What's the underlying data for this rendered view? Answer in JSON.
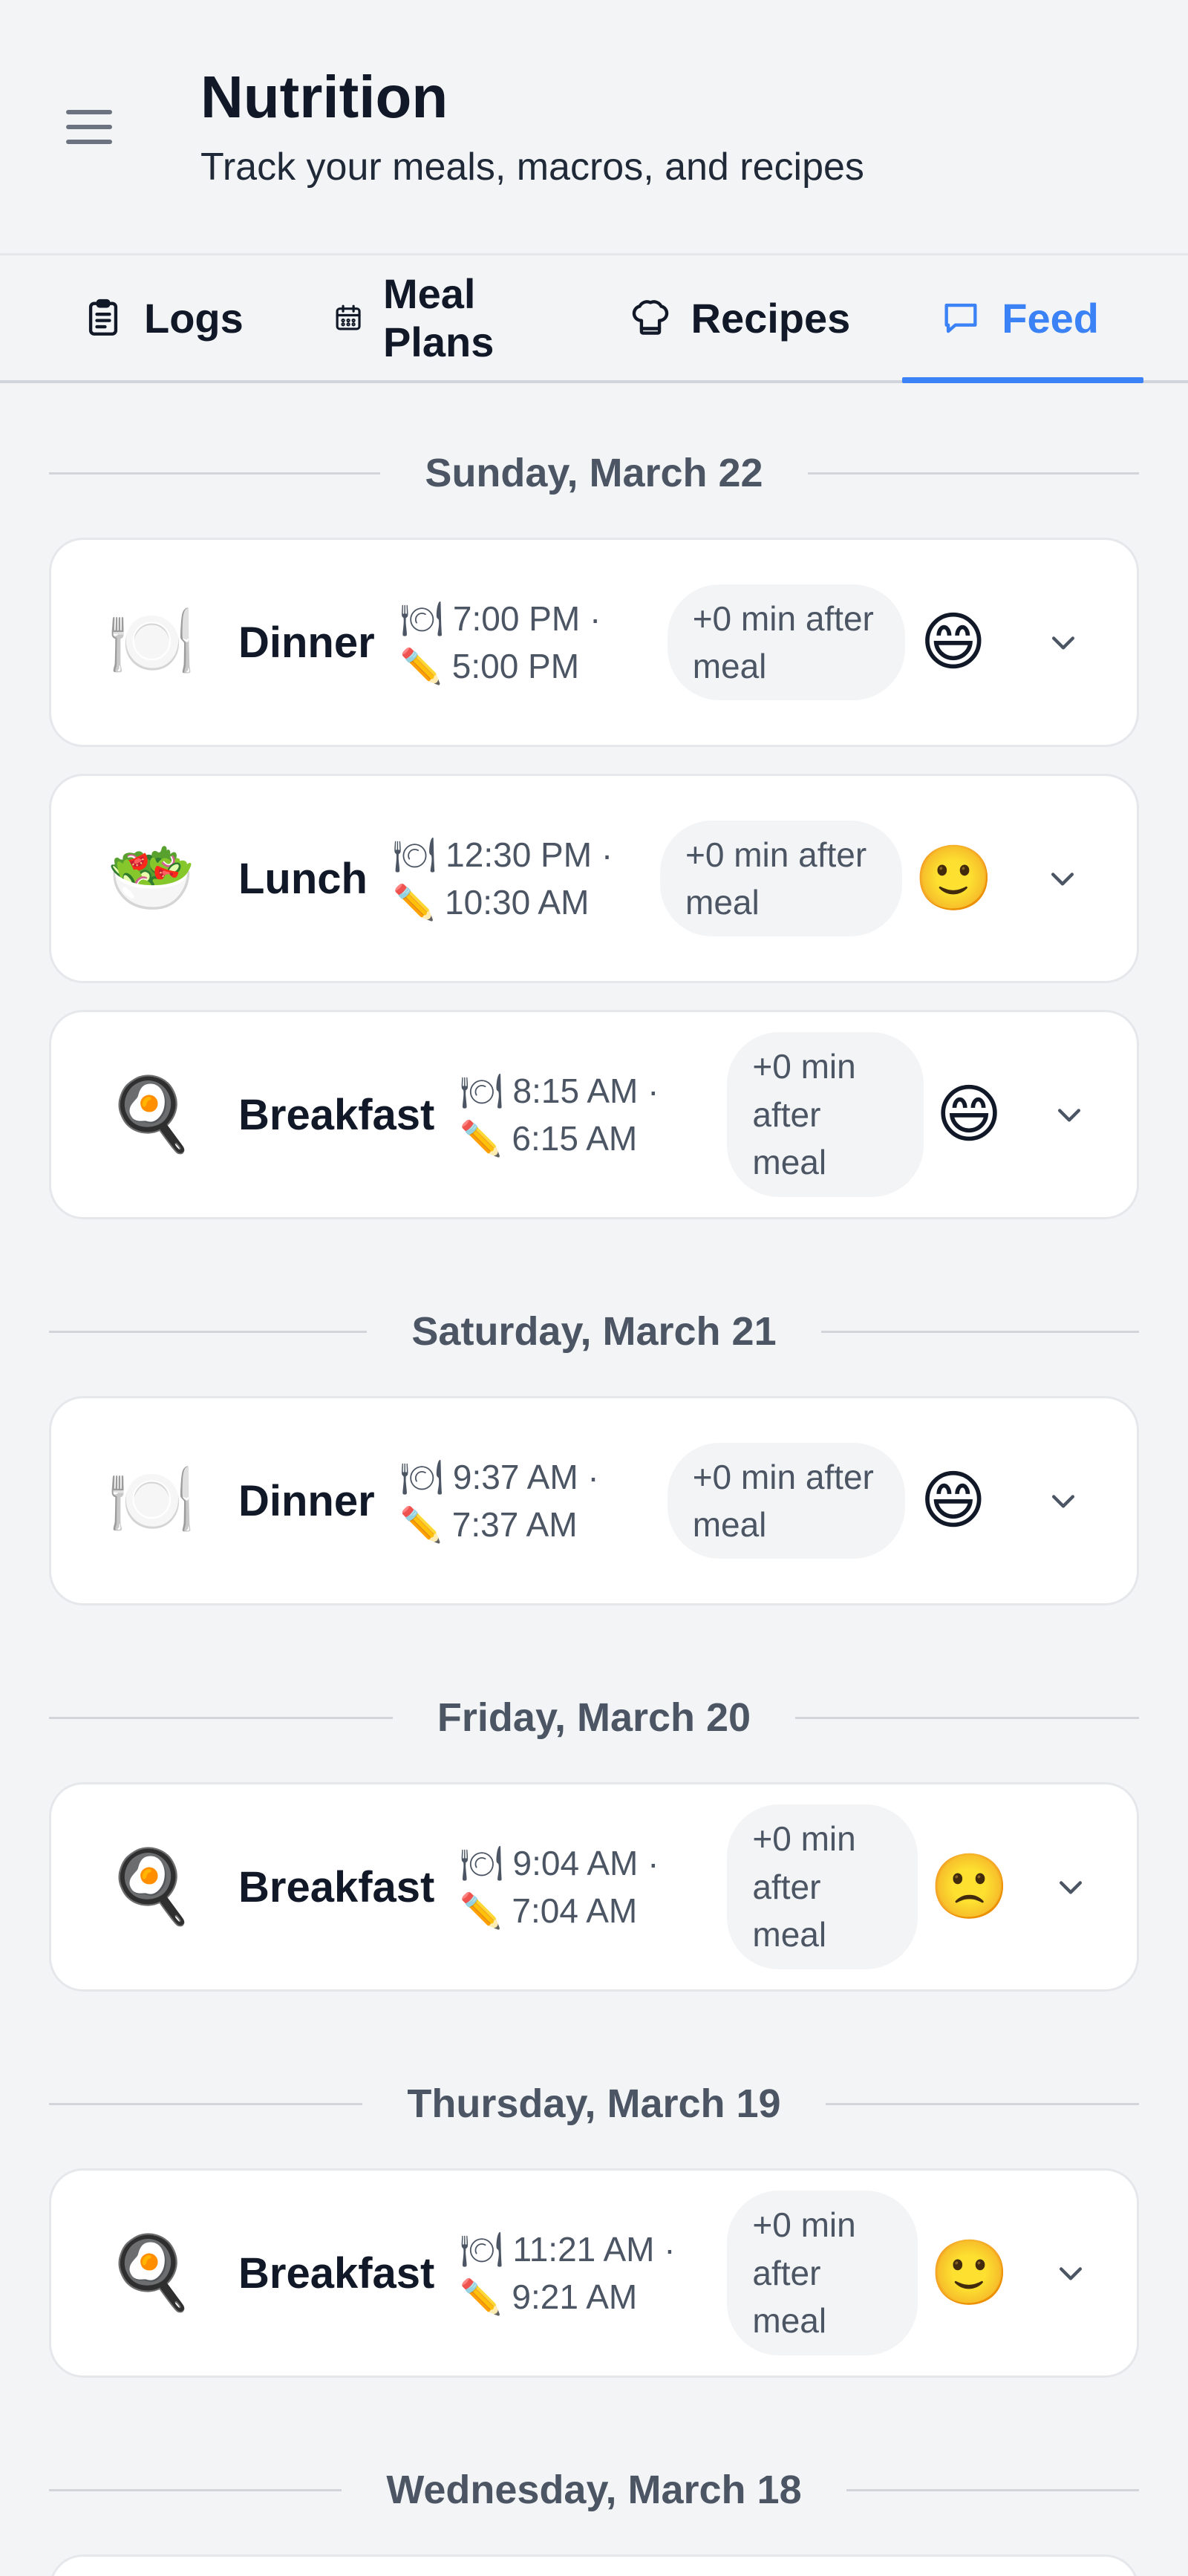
{
  "header": {
    "title": "Nutrition",
    "subtitle": "Track your meals, macros, and recipes"
  },
  "tabs": [
    {
      "label": "Logs",
      "icon": "clipboard-icon",
      "active": false
    },
    {
      "label": "Meal Plans",
      "icon": "calendar-icon",
      "active": false
    },
    {
      "label": "Recipes",
      "icon": "chef-hat-icon",
      "active": false
    },
    {
      "label": "Feed",
      "icon": "chat-icon",
      "active": true
    }
  ],
  "colors": {
    "accent": "#3b82f6",
    "text": "#111827",
    "muted": "#6b7280"
  },
  "feed": [
    {
      "date": "Sunday, March 22",
      "meals": [
        {
          "name": "Dinner",
          "icon": "🍽️",
          "meal_time": "🍽 7:00 PM ·",
          "logged_time": "✏️ 5:00 PM",
          "delta": "+0 min after meal",
          "mood": "😄"
        },
        {
          "name": "Lunch",
          "icon": "🥗",
          "meal_time": "🍽 12:30 PM ·",
          "logged_time": "✏️ 10:30 AM",
          "delta": "+0 min after meal",
          "mood": "🙂"
        },
        {
          "name": "Breakfast",
          "icon": "🍳",
          "meal_time": "🍽 8:15 AM ·",
          "logged_time": "✏️ 6:15 AM",
          "delta": "+0 min after meal",
          "mood": "😄"
        }
      ]
    },
    {
      "date": "Saturday, March 21",
      "meals": [
        {
          "name": "Dinner",
          "icon": "🍽️",
          "meal_time": "🍽 9:37 AM ·",
          "logged_time": "✏️ 7:37 AM",
          "delta": "+0 min after meal",
          "mood": "😄"
        }
      ]
    },
    {
      "date": "Friday, March 20",
      "meals": [
        {
          "name": "Breakfast",
          "icon": "🍳",
          "meal_time": "🍽 9:04 AM ·",
          "logged_time": "✏️ 7:04 AM",
          "delta": "+0 min after meal",
          "mood": "🙁"
        }
      ]
    },
    {
      "date": "Thursday, March 19",
      "meals": [
        {
          "name": "Breakfast",
          "icon": "🍳",
          "meal_time": "🍽 11:21 AM ·",
          "logged_time": "✏️ 9:21 AM",
          "delta": "+0 min after meal",
          "mood": "🙂"
        }
      ]
    },
    {
      "date": "Wednesday, March 18",
      "meals": []
    }
  ]
}
